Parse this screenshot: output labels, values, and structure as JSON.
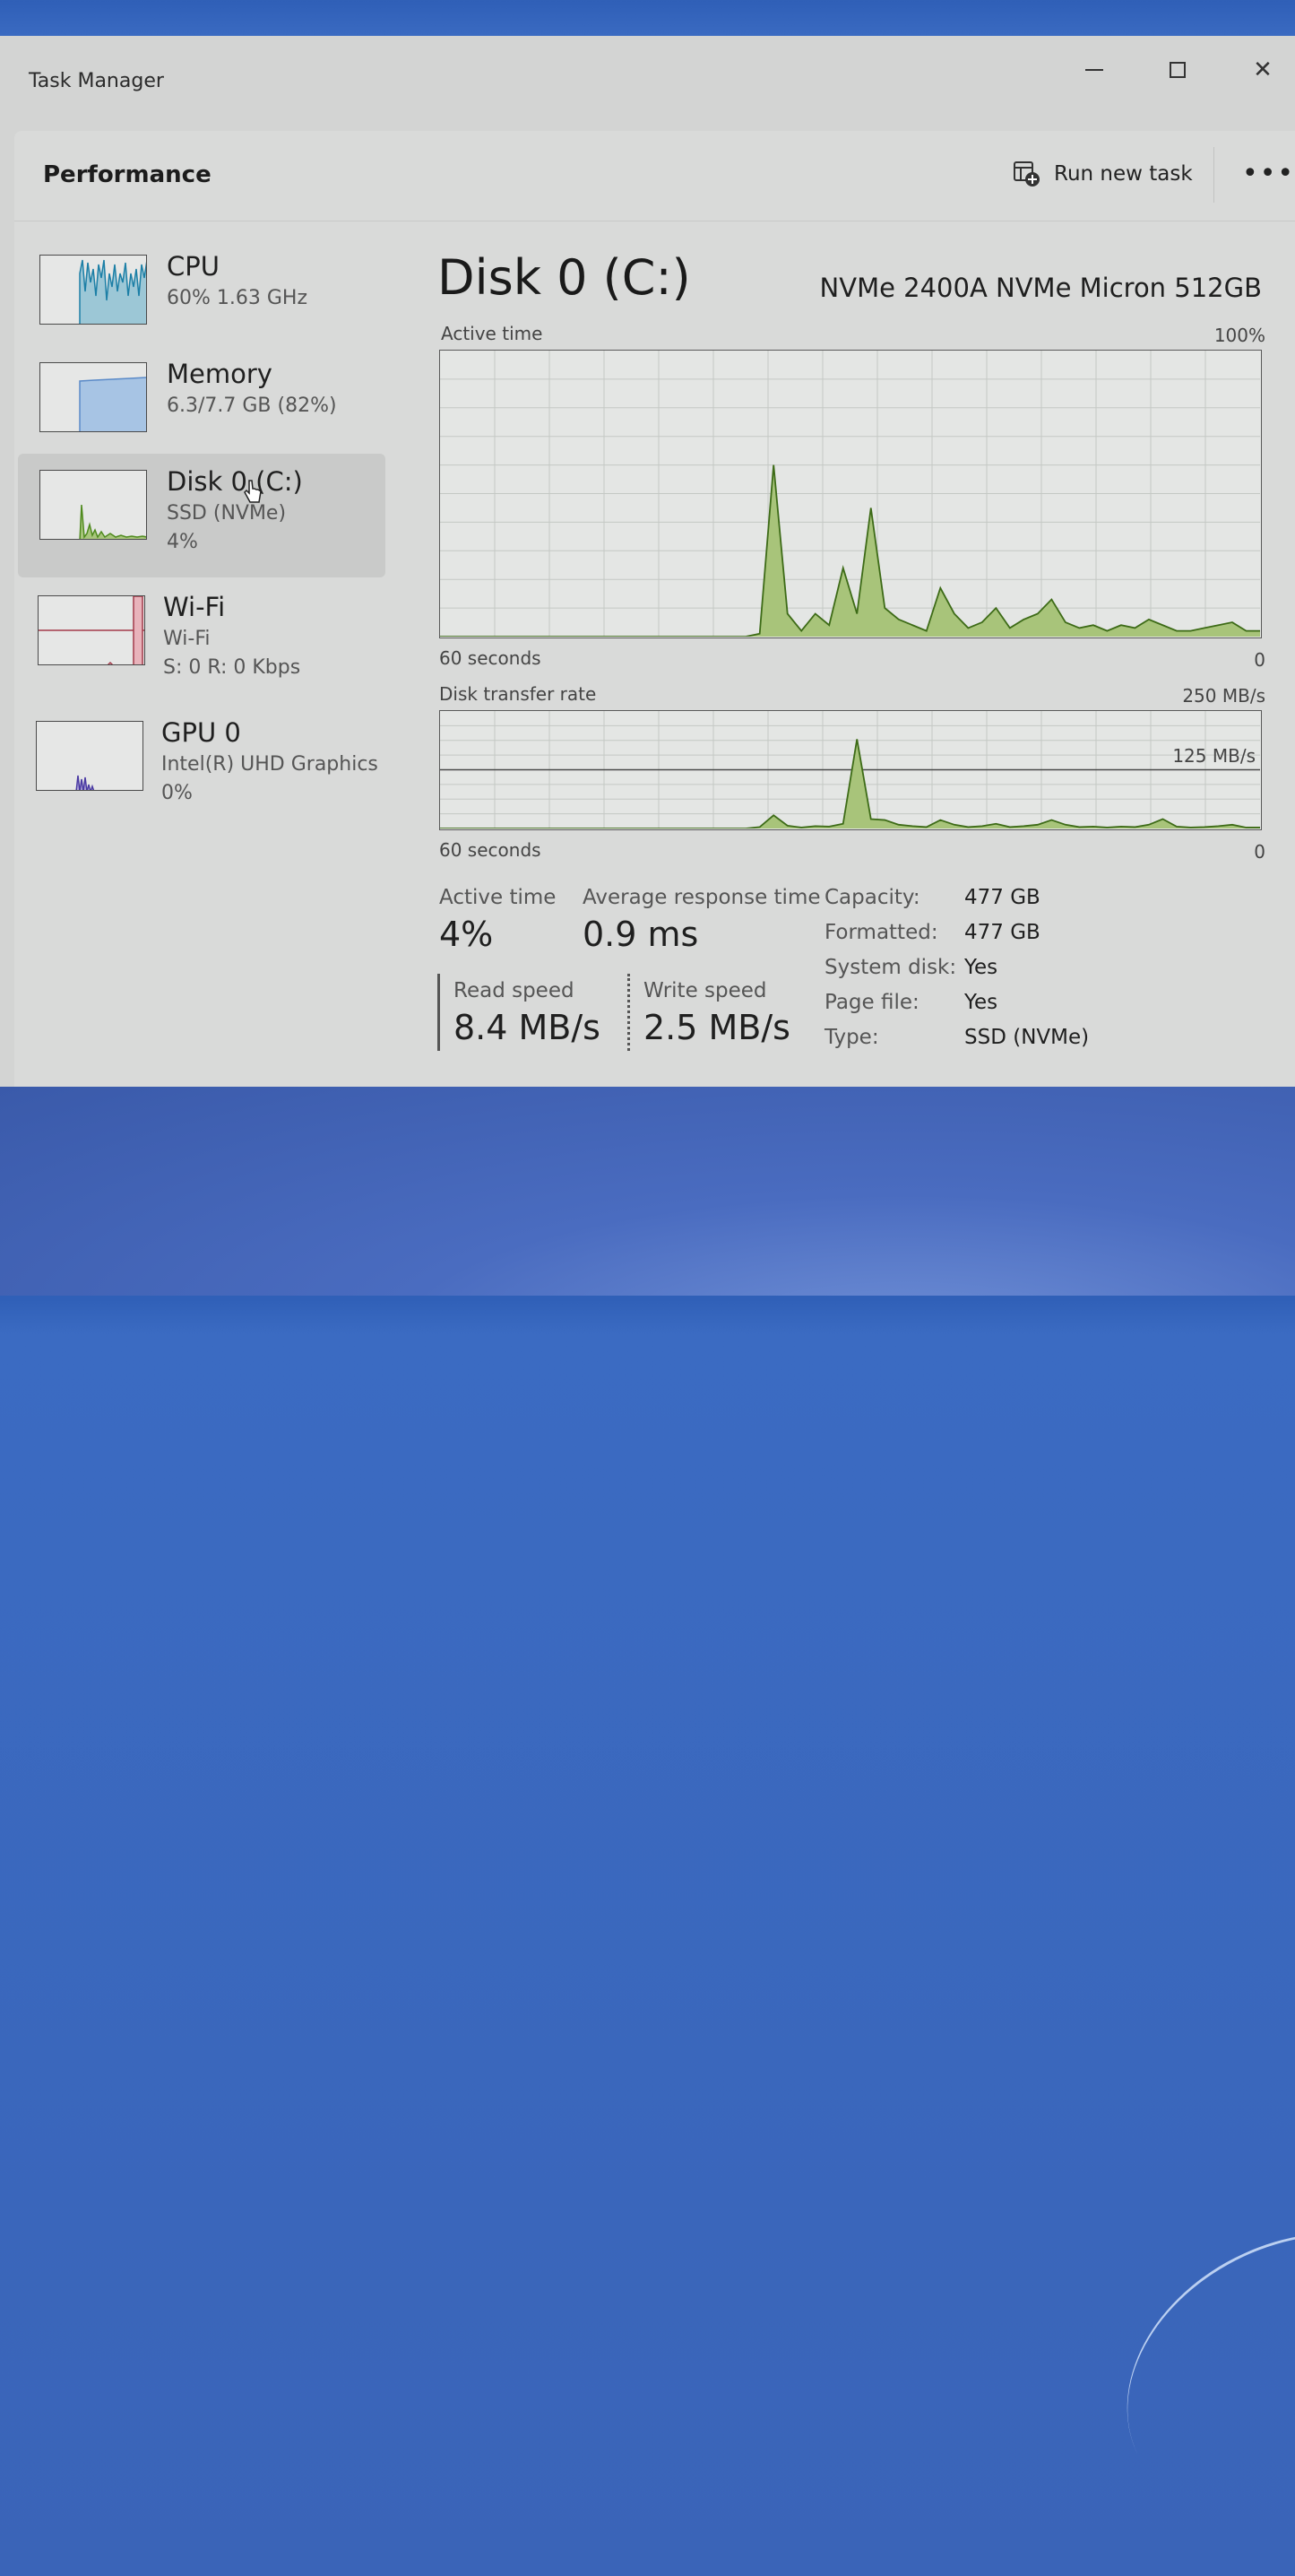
{
  "window": {
    "title": "Task Manager"
  },
  "header": {
    "section_title": "Performance",
    "run_new_task_label": "Run new task",
    "more_label": "•••"
  },
  "sidebar": {
    "items": [
      {
        "name": "CPU",
        "sub": "60%  1.63 GHz",
        "sub2": "",
        "color": "#1c7fa6"
      },
      {
        "name": "Memory",
        "sub": "6.3/7.7 GB (82%)",
        "sub2": "",
        "color": "#5a8ac8"
      },
      {
        "name": "Disk 0 (C:)",
        "sub": "SSD (NVMe)",
        "sub2": "4%",
        "color": "#4f8a1e",
        "selected": true
      },
      {
        "name": "Wi-Fi",
        "sub": "Wi-Fi",
        "sub2": "S: 0 R: 0 Kbps",
        "color": "#a33a4a"
      },
      {
        "name": "GPU 0",
        "sub": "Intel(R) UHD Graphics",
        "sub2": "0%",
        "color": "#4a3aa3"
      }
    ]
  },
  "main": {
    "disk_title": "Disk 0 (C:)",
    "disk_model": "NVMe 2400A NVMe Micron 512GB",
    "active_chart": {
      "label": "Active time",
      "max_label": "100%",
      "time_label": "60 seconds",
      "min_label": "0"
    },
    "transfer_chart": {
      "label": "Disk transfer rate",
      "max_label": "250 MB/s",
      "mid_label": "125 MB/s",
      "time_label": "60 seconds",
      "min_label": "0"
    },
    "stats": {
      "active_time_label": "Active time",
      "active_time_value": "4%",
      "response_label": "Average response time",
      "response_value": "0.9 ms",
      "read_label": "Read speed",
      "read_value": "8.4 MB/s",
      "write_label": "Write speed",
      "write_value": "2.5 MB/s"
    },
    "properties": [
      {
        "key": "Capacity:",
        "value": "477 GB"
      },
      {
        "key": "Formatted:",
        "value": "477 GB"
      },
      {
        "key": "System disk:",
        "value": "Yes"
      },
      {
        "key": "Page file:",
        "value": "Yes"
      },
      {
        "key": "Type:",
        "value": "SSD (NVMe)"
      }
    ]
  },
  "chart_data": [
    {
      "type": "area",
      "title": "Active time",
      "ylabel": "",
      "ylim": [
        0,
        100
      ],
      "x_range_seconds": 60,
      "values": [
        0,
        0,
        0,
        0,
        0,
        0,
        0,
        0,
        0,
        0,
        0,
        0,
        0,
        0,
        0,
        0,
        0,
        0,
        0,
        0,
        0,
        0,
        0,
        1,
        60,
        8,
        2,
        8,
        4,
        24,
        8,
        45,
        10,
        6,
        4,
        2,
        17,
        8,
        3,
        5,
        10,
        3,
        6,
        8,
        13,
        5,
        3,
        4,
        2,
        4,
        3,
        6,
        4,
        2,
        2,
        3,
        4,
        5,
        2,
        2
      ]
    },
    {
      "type": "area",
      "title": "Disk transfer rate",
      "ylabel": "",
      "ylim": [
        0,
        250
      ],
      "ytick_labels": [
        "250 MB/s",
        "125 MB/s",
        "0"
      ],
      "x_range_seconds": 60,
      "values": [
        0,
        0,
        0,
        0,
        0,
        0,
        0,
        0,
        0,
        0,
        0,
        0,
        0,
        0,
        0,
        0,
        0,
        0,
        0,
        0,
        0,
        0,
        0,
        3,
        28,
        6,
        2,
        5,
        4,
        10,
        190,
        20,
        18,
        8,
        5,
        3,
        18,
        8,
        3,
        5,
        10,
        3,
        5,
        8,
        18,
        8,
        3,
        4,
        2,
        4,
        3,
        8,
        20,
        4,
        2,
        3,
        5,
        8,
        2,
        2
      ]
    }
  ]
}
